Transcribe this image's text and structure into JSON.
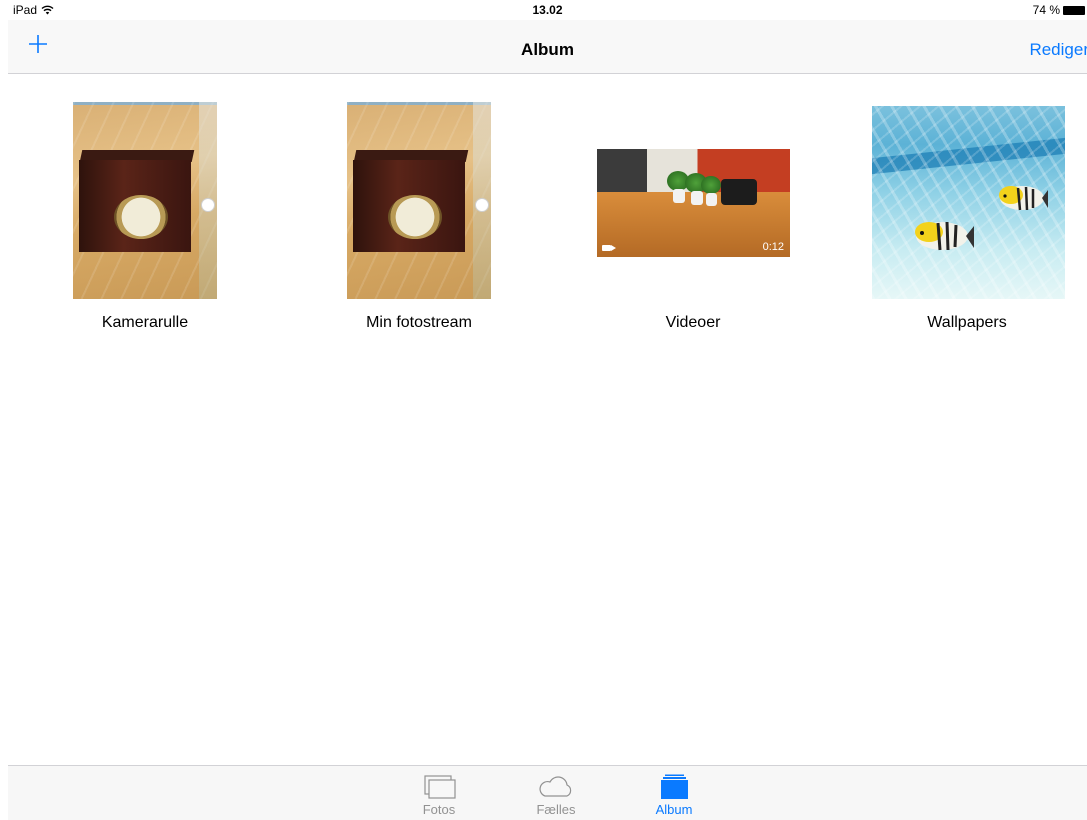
{
  "status": {
    "device": "iPad",
    "time": "13.02",
    "battery": "74 %"
  },
  "navbar": {
    "title": "Album",
    "edit_label": "Rediger",
    "add_icon": "plus-icon"
  },
  "albums": [
    {
      "label": "Kamerarulle"
    },
    {
      "label": "Min fotostream"
    },
    {
      "label": "Videoer",
      "duration": "0:12"
    },
    {
      "label": "Wallpapers"
    }
  ],
  "tabs": [
    {
      "label": "Fotos",
      "icon": "photos-icon",
      "active": false
    },
    {
      "label": "Fælles",
      "icon": "cloud-icon",
      "active": false
    },
    {
      "label": "Album",
      "icon": "album-icon",
      "active": true
    }
  ],
  "colors": {
    "accent": "#0a7aff",
    "inactive": "#929292"
  }
}
